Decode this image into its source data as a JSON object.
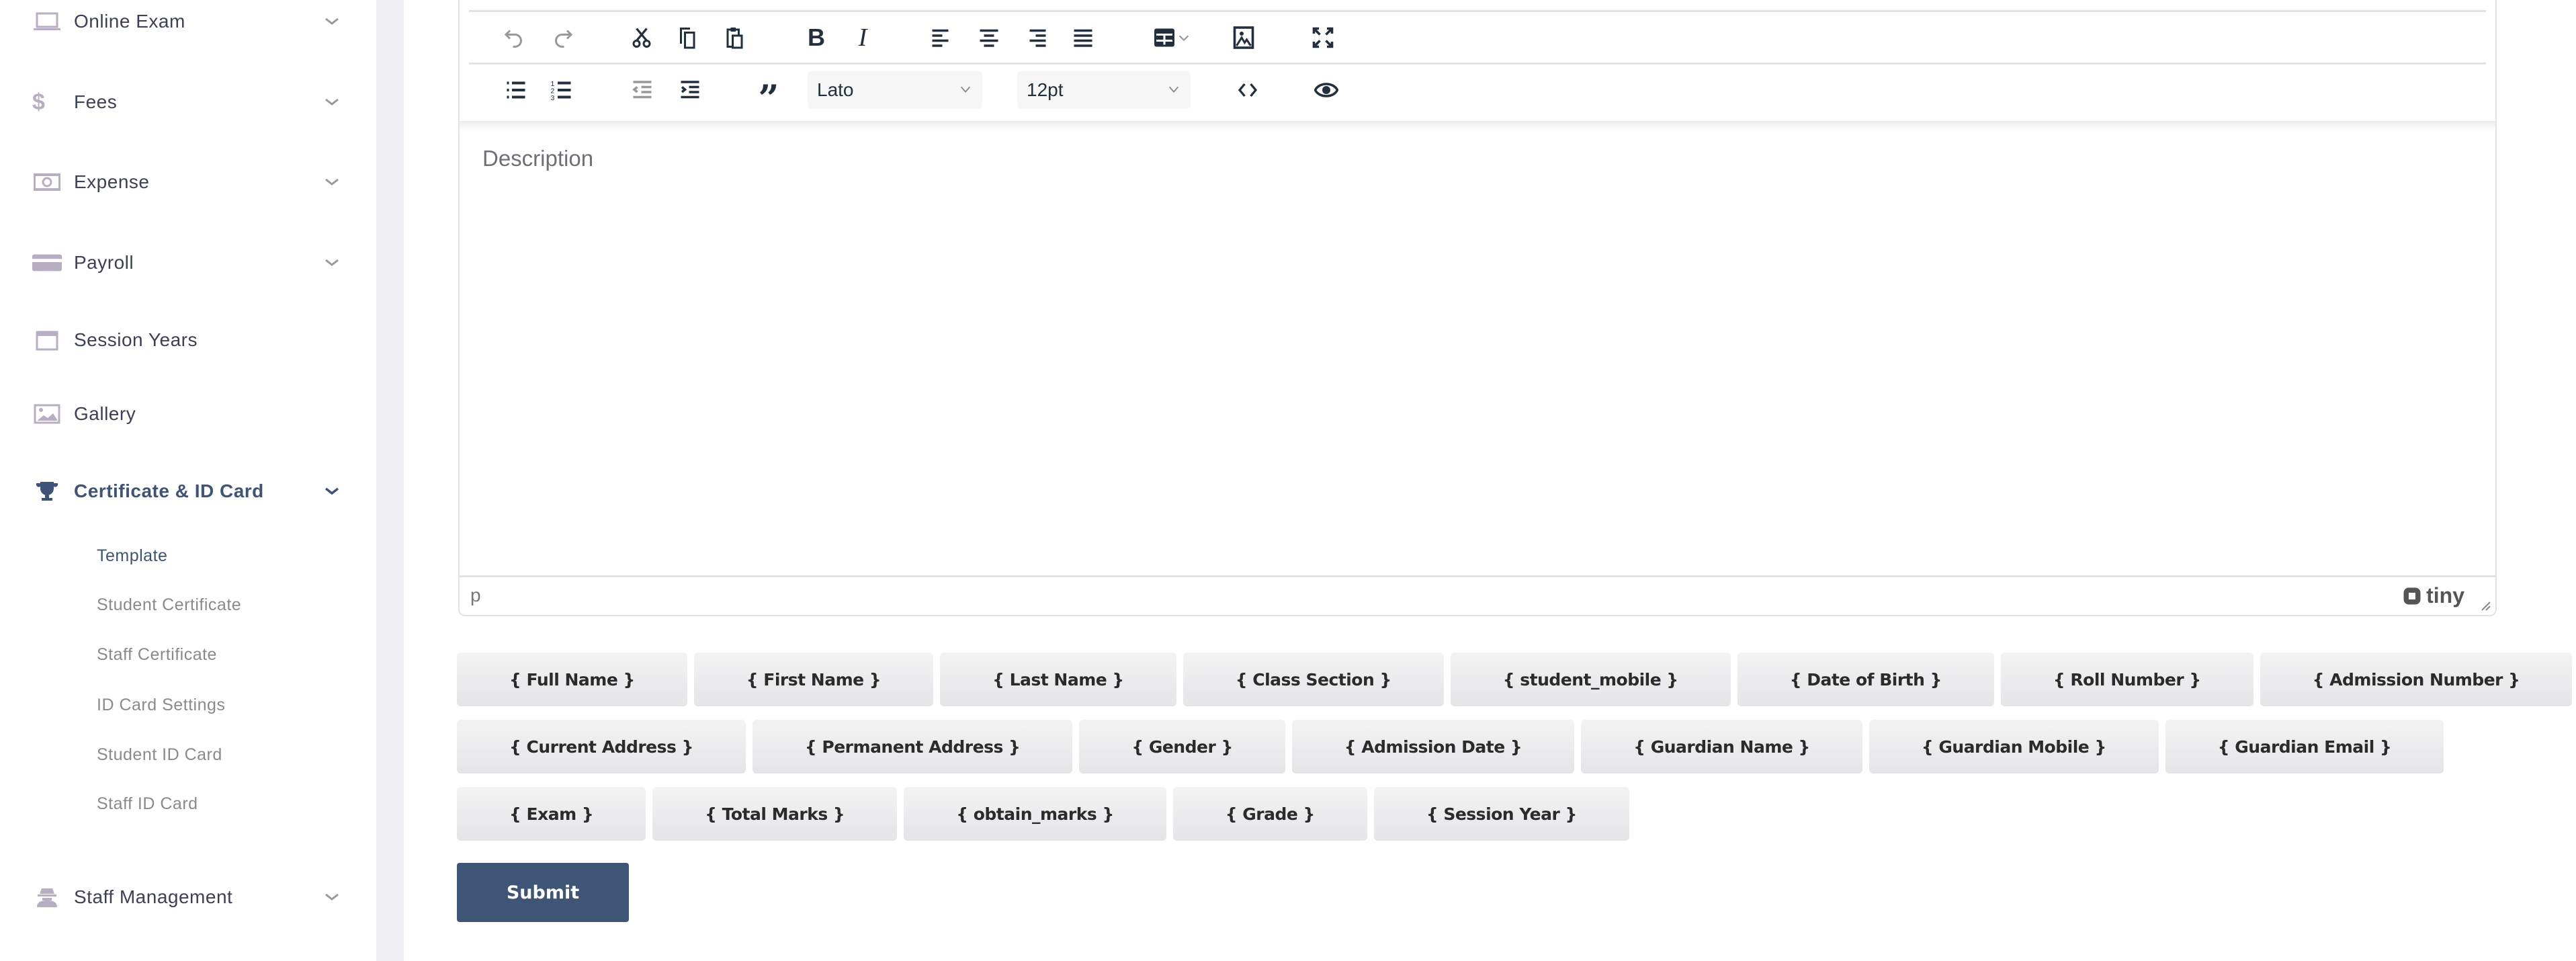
{
  "sidebar": {
    "items": [
      {
        "label": "Online Exam",
        "icon": "laptop-icon"
      },
      {
        "label": "Fees",
        "icon": "dollar-icon"
      },
      {
        "label": "Expense",
        "icon": "money-bill-icon"
      },
      {
        "label": "Payroll",
        "icon": "credit-card-icon"
      },
      {
        "label": "Session Years",
        "icon": "calendar-icon"
      },
      {
        "label": "Gallery",
        "icon": "image-icon"
      },
      {
        "label": "Certificate & ID Card",
        "icon": "trophy-icon",
        "active": true
      },
      {
        "label": "Staff Management",
        "icon": "user-secret-icon"
      }
    ],
    "sub_items": [
      "Template",
      "Student Certificate",
      "Staff Certificate",
      "ID Card Settings",
      "Student ID Card",
      "Staff ID Card"
    ],
    "active_sub": "Template"
  },
  "editor": {
    "font_family": "Lato",
    "font_size": "12pt",
    "placeholder": "Description",
    "path": "p",
    "brand": "tiny"
  },
  "placeholders": {
    "row1": [
      "{ Full Name }",
      "{ First Name }",
      "{ Last Name }",
      "{ Class Section }",
      "{ student_mobile }",
      "{ Date of Birth }",
      "{ Roll Number }",
      "{ Admission Number }"
    ],
    "row2": [
      "{ Current Address }",
      "{ Permanent Address }",
      "{ Gender }",
      "{ Admission Date }",
      "{ Guardian Name }",
      "{ Guardian Mobile }",
      "{ Guardian Email }"
    ],
    "row3": [
      "{ Exam }",
      "{ Total Marks }",
      "{ obtain_marks }",
      "{ Grade }",
      "{ Session Year }"
    ]
  },
  "submit_label": "Submit",
  "colors": {
    "accent": "#3e5576",
    "icon": "#b8aec4",
    "gutter": "#efeef3"
  }
}
